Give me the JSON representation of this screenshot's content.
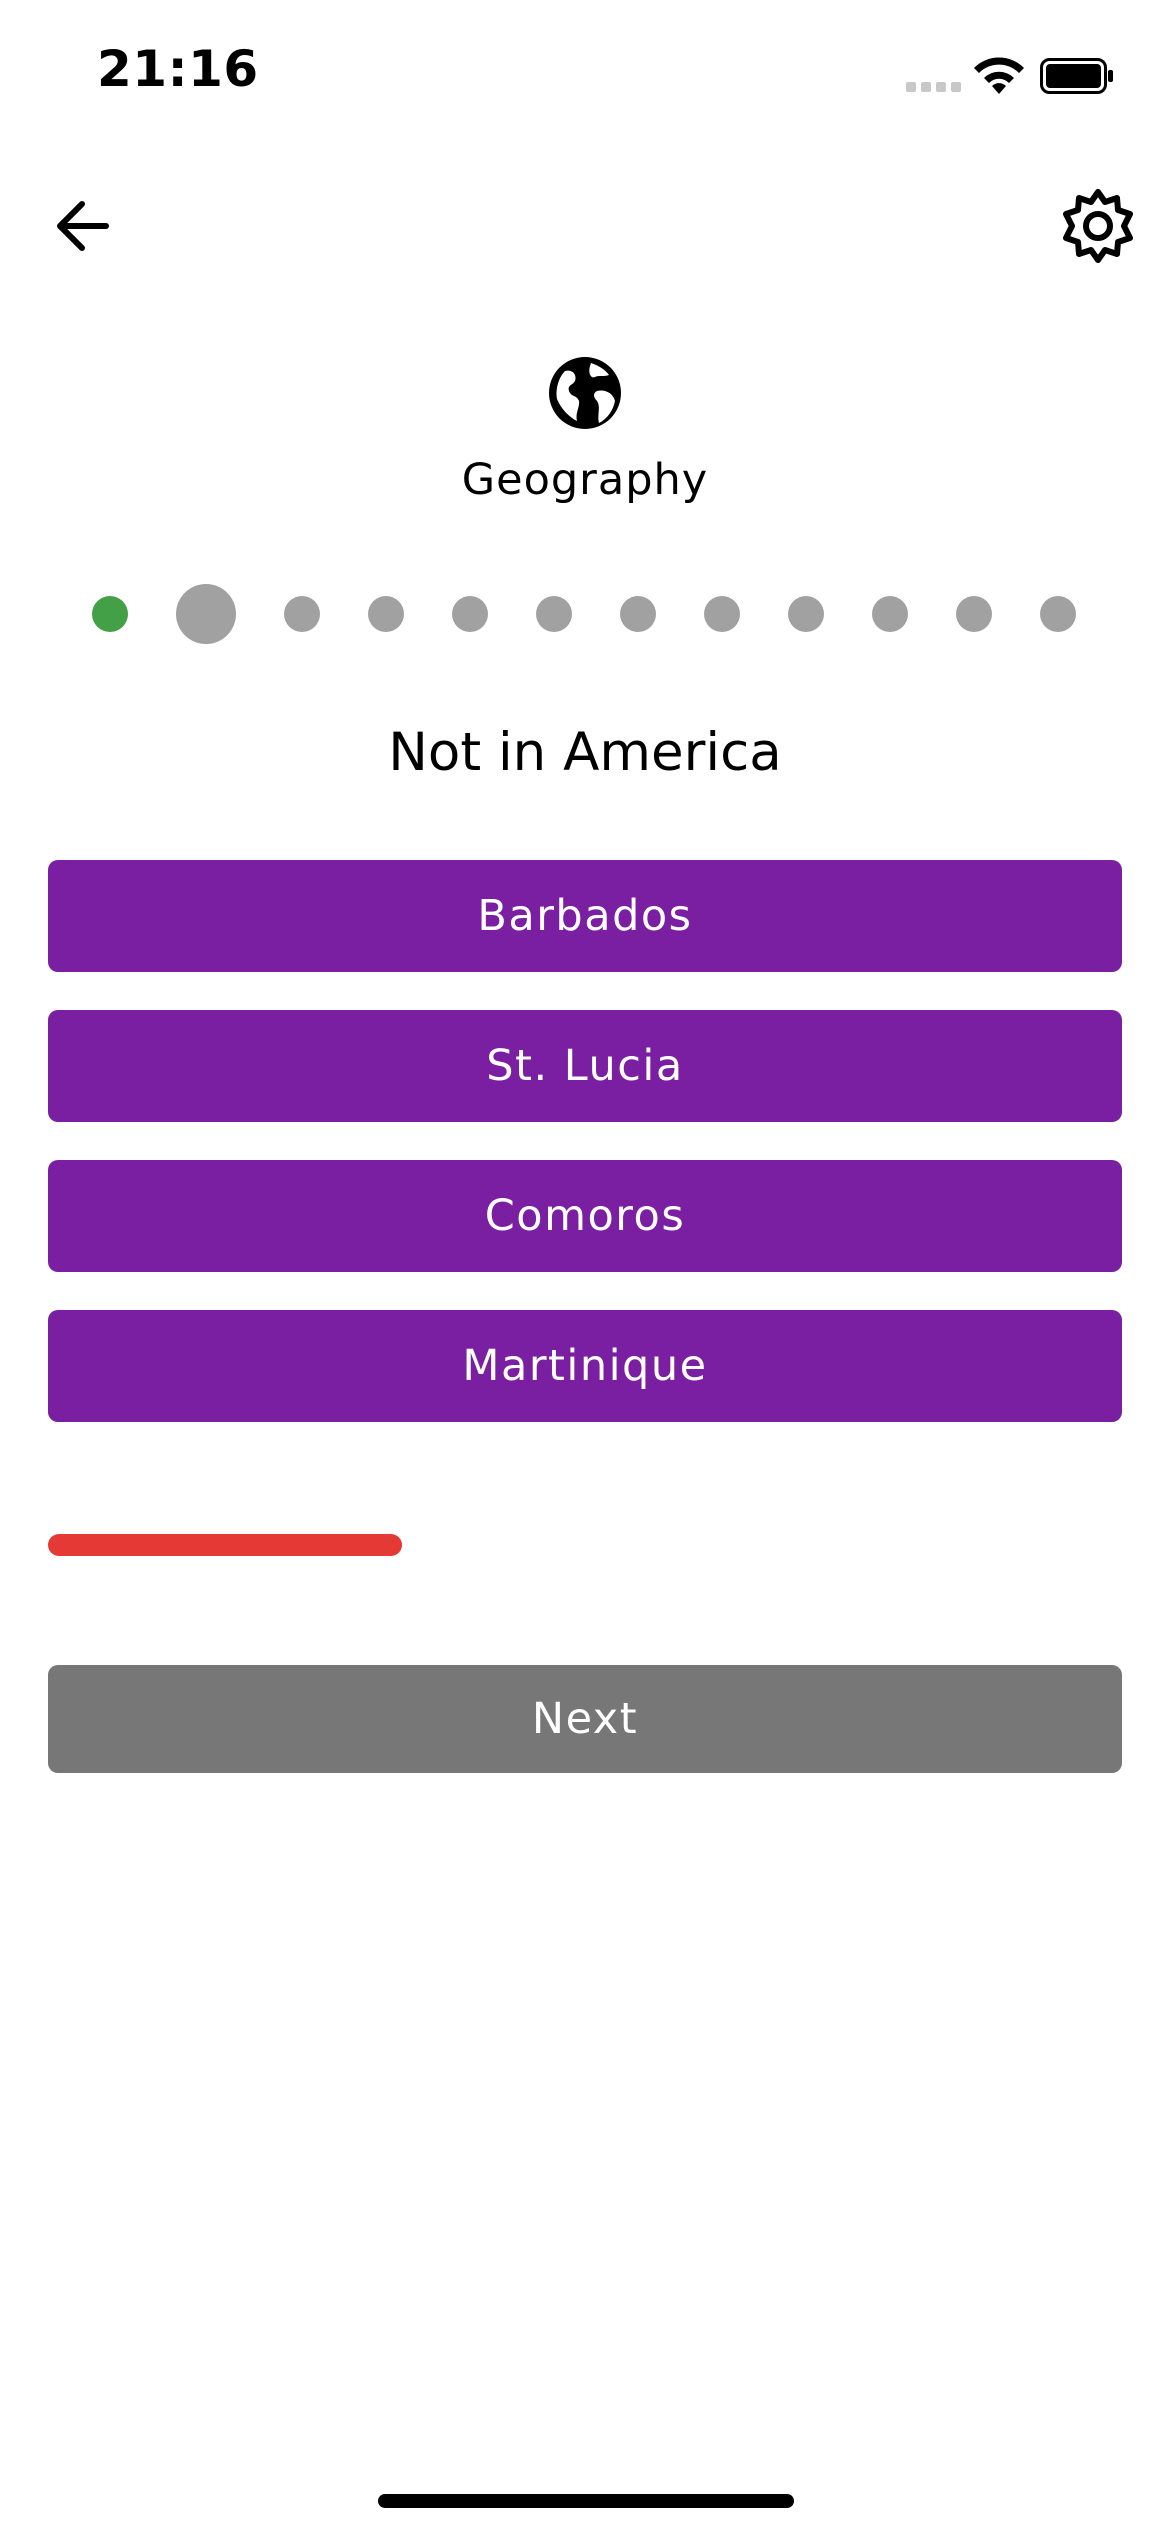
{
  "status_bar": {
    "time": "21:16",
    "icons": [
      "signal-icon",
      "wifi-icon",
      "battery-icon"
    ]
  },
  "header": {
    "back_icon": "arrow-left-icon",
    "settings_icon": "gear-icon"
  },
  "category": {
    "icon": "globe-icon",
    "title": "Geography"
  },
  "progress_dots": {
    "total": 12,
    "current_index": 1,
    "states": [
      "correct",
      "current",
      "pending",
      "pending",
      "pending",
      "pending",
      "pending",
      "pending",
      "pending",
      "pending",
      "pending",
      "pending"
    ]
  },
  "question": {
    "text": "Not in America"
  },
  "answers": [
    {
      "label": "Barbados"
    },
    {
      "label": "St. Lucia"
    },
    {
      "label": "Comoros"
    },
    {
      "label": "Martinique"
    }
  ],
  "timer": {
    "remaining_fraction": 0.33
  },
  "next_button": {
    "label": "Next"
  },
  "colors": {
    "answer_bg": "#7b1fa2",
    "correct_dot": "#43a047",
    "pending_dot": "#a1a1a1",
    "timer": "#e53935",
    "next_bg": "#777777"
  }
}
